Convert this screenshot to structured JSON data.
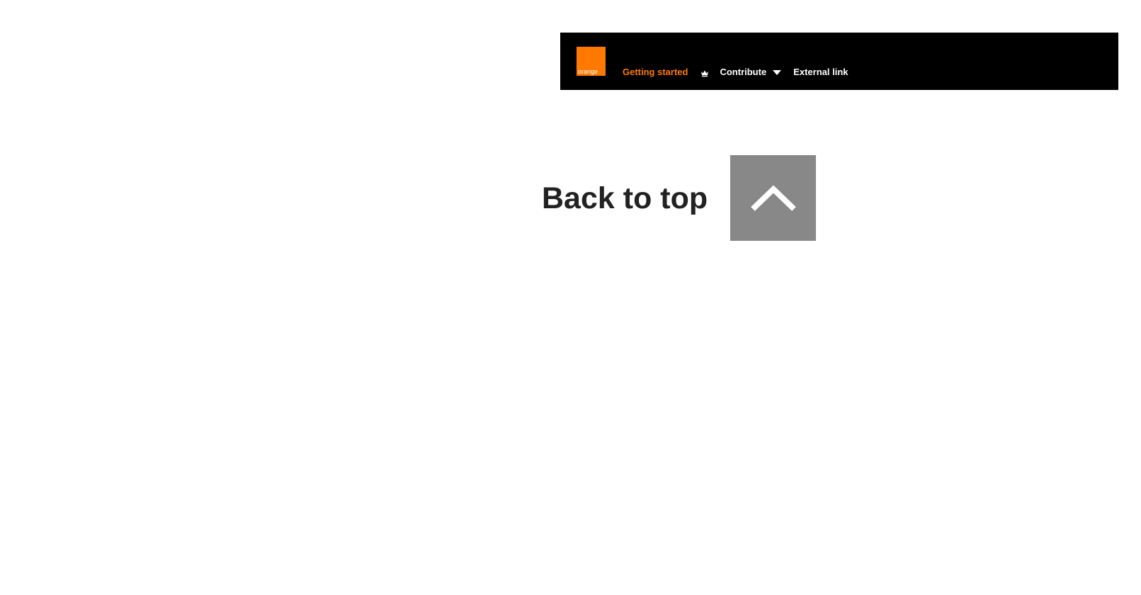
{
  "navbar": {
    "logo_text": "orange",
    "links": {
      "getting_started": "Getting started",
      "contribute": "Contribute",
      "external": "External link"
    },
    "icons": {
      "community_icon": "crown-icon",
      "dropdown_icon": "chevron-down-icon"
    },
    "colors": {
      "background": "#000000",
      "brand": "#ff7900",
      "text": "#ffffff"
    }
  },
  "back_to_top": {
    "label": "Back to top",
    "icon": "chevron-up-icon",
    "button_color": "#888888"
  }
}
